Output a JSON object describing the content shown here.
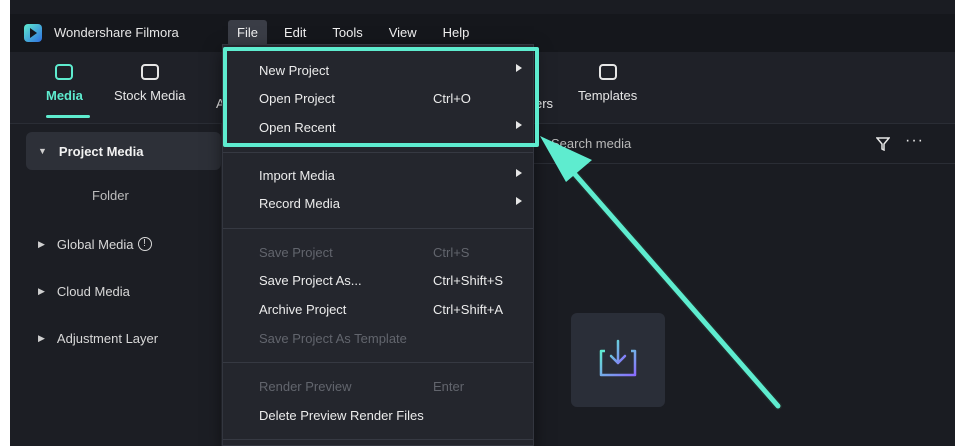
{
  "app": {
    "title": "Wondershare Filmora"
  },
  "menubar": [
    "File",
    "Edit",
    "Tools",
    "View",
    "Help"
  ],
  "toolbar": {
    "tabs": [
      {
        "label": "Media",
        "icon": "media-icon"
      },
      {
        "label": "Stock Media",
        "icon": "stock-media-icon"
      },
      {
        "label": "A",
        "icon": "audio-icon"
      },
      {
        "label": "ers",
        "icon": "filters-icon"
      },
      {
        "label": "Templates",
        "icon": "templates-icon"
      }
    ]
  },
  "sidebar": {
    "project_media": "Project Media",
    "folder": "Folder",
    "global_media": "Global Media",
    "info_glyph": "!",
    "cloud_media": "Cloud Media",
    "adjustment_layer": "Adjustment Layer"
  },
  "search": {
    "placeholder": "Search media"
  },
  "more_glyph": "···",
  "file_menu": {
    "new_project": "New Project",
    "open_project": "Open Project",
    "open_project_shortcut": "Ctrl+O",
    "open_recent": "Open Recent",
    "import_media": "Import Media",
    "record_media": "Record Media",
    "save_project": "Save Project",
    "save_project_shortcut": "Ctrl+S",
    "save_project_as": "Save Project As...",
    "save_project_as_shortcut": "Ctrl+Shift+S",
    "archive_project": "Archive Project",
    "archive_project_shortcut": "Ctrl+Shift+A",
    "save_as_template": "Save Project As Template",
    "render_preview": "Render Preview",
    "render_preview_shortcut": "Enter",
    "delete_preview": "Delete Preview Render Files"
  },
  "colors": {
    "accent": "#5eeccf",
    "background": "#1a1c22",
    "menu": "#24262d"
  }
}
